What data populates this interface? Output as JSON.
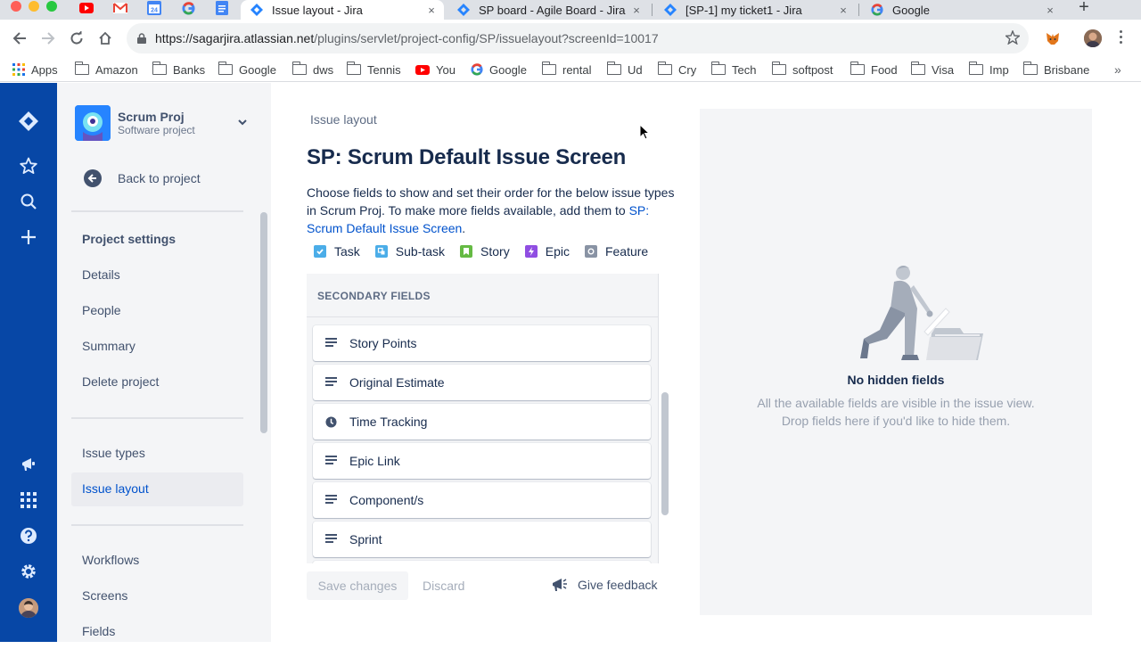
{
  "browser": {
    "tabs": [
      {
        "title": "Issue layout - Jira",
        "active": true
      },
      {
        "title": "SP board - Agile Board - Jira",
        "active": false
      },
      {
        "title": "[SP-1] my ticket1 - Jira",
        "active": false
      },
      {
        "title": "Google",
        "active": false
      }
    ],
    "tab_close": "×",
    "new_tab": "+",
    "pinned_tabs": [
      "youtube-icon",
      "gmail-icon",
      "calendar-icon",
      "google-icon",
      "docs-icon"
    ],
    "url_host": "https://sagarjira.atlassian.net",
    "url_path": "/plugins/servlet/project-config/SP/issuelayout?screenId=10017",
    "bookmarks": [
      "Apps",
      "Amazon",
      "Banks",
      "Google",
      "dws",
      "Tennis",
      "You",
      "Google",
      "rental",
      "Ud",
      "Cry",
      "Tech",
      "softpost",
      "Food",
      "Visa",
      "Imp",
      "Brisbane"
    ],
    "bookmarks_more": "»"
  },
  "sidebar": {
    "project_name": "Scrum Proj",
    "project_type": "Software project",
    "back_label": "Back to project",
    "settings_heading": "Project settings",
    "items_group1": [
      "Details",
      "People",
      "Summary",
      "Delete project"
    ],
    "items_group2": [
      "Issue types",
      "Issue layout"
    ],
    "selected_item": "Issue layout",
    "items_group3": [
      "Workflows",
      "Screens",
      "Fields"
    ]
  },
  "main": {
    "breadcrumb": "Issue layout",
    "title": "SP: Scrum Default Issue Screen",
    "description_prefix": "Choose fields to show and set their order for the below issue types in Scrum Proj. To make more fields available, add them to ",
    "description_link": "SP: Scrum Default Issue Screen",
    "description_suffix": ".",
    "issue_types": [
      {
        "label": "Task",
        "color": "#4bade8",
        "icon": "check-icon"
      },
      {
        "label": "Sub-task",
        "color": "#4bade8",
        "icon": "subtask-icon"
      },
      {
        "label": "Story",
        "color": "#65ba43",
        "icon": "bookmark-icon"
      },
      {
        "label": "Epic",
        "color": "#904ee2",
        "icon": "lightning-icon"
      },
      {
        "label": "Feature",
        "color": "#8993a4",
        "icon": "circle-icon"
      }
    ],
    "secondary_heading": "SECONDARY FIELDS",
    "fields": [
      {
        "label": "Story Points",
        "icon": "text-lines-icon"
      },
      {
        "label": "Original Estimate",
        "icon": "text-lines-icon"
      },
      {
        "label": "Time Tracking",
        "icon": "clock-icon"
      },
      {
        "label": "Epic Link",
        "icon": "text-lines-icon"
      },
      {
        "label": "Component/s",
        "icon": "text-lines-icon"
      },
      {
        "label": "Sprint",
        "icon": "text-lines-icon"
      }
    ],
    "save_label": "Save changes",
    "discard_label": "Discard",
    "feedback_label": "Give feedback"
  },
  "hidden_panel": {
    "title": "No hidden fields",
    "text_line1": "All the available fields are visible in the issue view.",
    "text_line2": "Drop fields here if you'd like to hide them."
  },
  "colors": {
    "jira_nav": "#0747a6",
    "link": "#0052cc",
    "sidebar_bg": "#f4f5f7"
  }
}
